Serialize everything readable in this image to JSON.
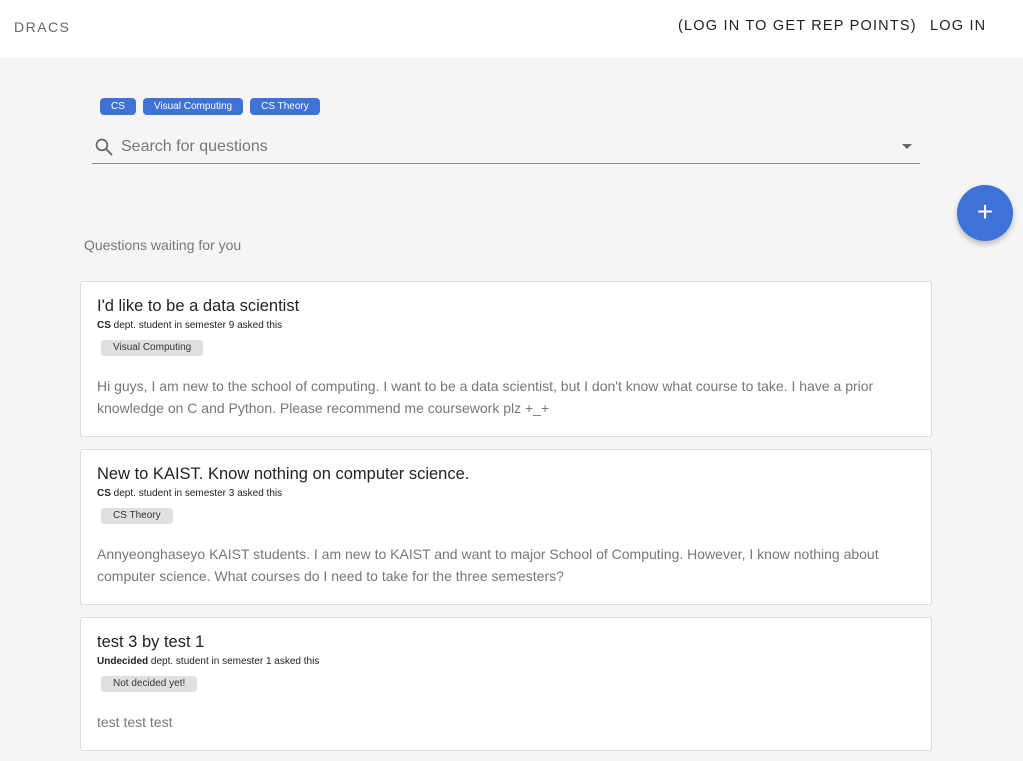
{
  "header": {
    "brand": "DRACS",
    "rep_label": "(LOG IN TO GET REP POINTS)",
    "login_label": "LOG IN"
  },
  "filters": {
    "chips": [
      "CS",
      "Visual Computing",
      "CS Theory"
    ]
  },
  "search": {
    "placeholder": "Search for questions",
    "value": ""
  },
  "fab": {
    "label": "+"
  },
  "main": {
    "section_title": "Questions waiting for you",
    "questions": [
      {
        "title": "I'd like to be a data scientist",
        "dept": "CS",
        "meta_rest": " dept. student in semester 9 asked this",
        "tag": "Visual Computing",
        "body": "Hi guys, I am new to the school of computing. I want to be a data scientist, but I don't know what course to take. I have a prior knowledge on C and Python. Please recommend me coursework plz +_+"
      },
      {
        "title": "New to KAIST. Know nothing on computer science.",
        "dept": "CS",
        "meta_rest": " dept. student in semester 3 asked this",
        "tag": "CS Theory",
        "body": "Annyeonghaseyo KAIST students. I am new to KAIST and want to major School of Computing. However, I know nothing about computer science. What courses do I need to take for the three semesters?"
      },
      {
        "title": "test 3 by test 1",
        "dept": "Undecided",
        "meta_rest": " dept. student in semester 1 asked this",
        "tag": "Not decided yet!",
        "body": "test test test"
      }
    ]
  },
  "colors": {
    "accent": "#3f72d6",
    "background": "#f5f5f5",
    "card": "#ffffff"
  }
}
